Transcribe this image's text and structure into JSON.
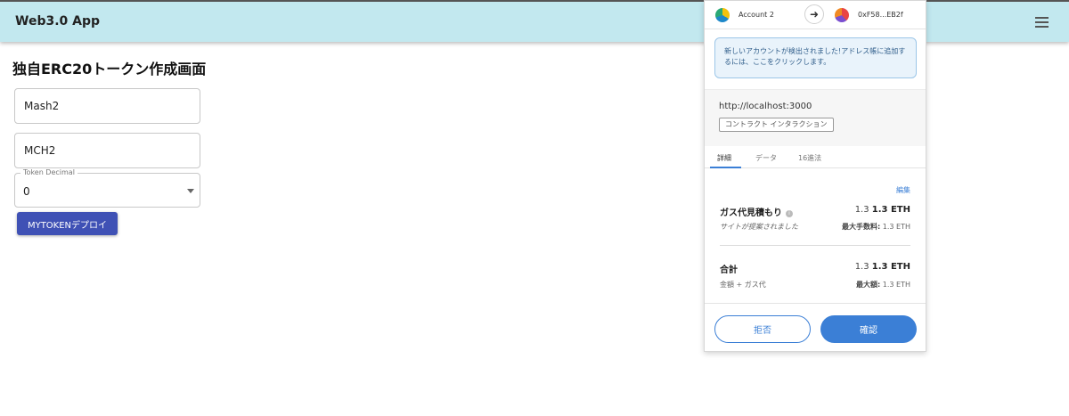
{
  "app": {
    "title": "Web3.0 App",
    "menu_icon": "hamburger-menu-icon"
  },
  "page": {
    "title": "独自ERC20トークン作成画面",
    "name_field": {
      "value": "Mash2"
    },
    "symbol_field": {
      "value": "MCH2"
    },
    "decimal_field": {
      "label": "Token Decimal",
      "value": "0"
    },
    "deploy_button": "MYTOKENデプロイ"
  },
  "wallet": {
    "from_account": "Account 2",
    "to_address": "0xF58...EB2f",
    "notice": "新しいアカウントが検出されました!アドレス帳に追加するには、ここをクリックします。",
    "origin_url": "http://localhost:3000",
    "origin_tag": "コントラクト インタラクション",
    "tabs": [
      {
        "label": "詳細",
        "active": true
      },
      {
        "label": "データ",
        "active": false
      },
      {
        "label": "16進法",
        "active": false
      }
    ],
    "edit_link": "編集",
    "gas": {
      "label": "ガス代見積もり",
      "amount_plain": "1.3",
      "amount_bold": "1.3 ETH",
      "sub": "サイトが提案されました",
      "max_label": "最大手数料:",
      "max_value": "1.3 ETH"
    },
    "total": {
      "label": "合計",
      "amount_plain": "1.3",
      "amount_bold": "1.3 ETH",
      "sub": "金額 + ガス代",
      "max_label": "最大額:",
      "max_value": "1.3 ETH"
    },
    "reject_button": "拒否",
    "confirm_button": "確認",
    "colors": {
      "accent": "#3b7fd6",
      "notice_bg": "#e9f3fb"
    }
  }
}
